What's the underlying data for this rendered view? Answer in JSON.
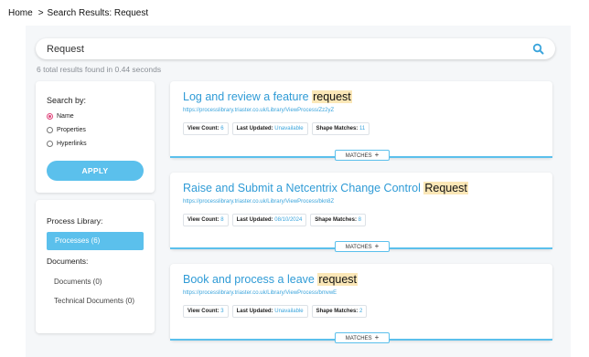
{
  "breadcrumb": {
    "home": "Home",
    "separator": ">",
    "current": "Search Results: Request"
  },
  "search": {
    "value": "Request",
    "placeholder": ""
  },
  "results_summary": "6 total results found in 0.44 seconds",
  "filter": {
    "title": "Search by:",
    "options": [
      {
        "label": "Name",
        "checked": true
      },
      {
        "label": "Properties",
        "checked": false
      },
      {
        "label": "Hyperlinks",
        "checked": false
      }
    ],
    "apply_label": "APPLY"
  },
  "library": {
    "process_heading": "Process Library:",
    "processes_label": "Processes (6)",
    "documents_heading": "Documents:",
    "documents_label": "Documents (0)",
    "technical_label": "Technical Documents (0)"
  },
  "labels": {
    "view_count": "View Count:",
    "last_updated": "Last Updated:",
    "shape_matches": "Shape Matches:",
    "matches": "MATCHES",
    "plus": "+"
  },
  "results": [
    {
      "title_pre": "Log and review a feature ",
      "title_hl": "request",
      "url": "https://processlibrary.triaster.co.uk/Library/ViewProcess/Zz2yZ",
      "view_count": "6",
      "last_updated": "Unavailable",
      "shape_matches": "11"
    },
    {
      "title_pre": "Raise and Submit a Netcentrix Change Control ",
      "title_hl": "Request",
      "url": "https://processlibrary.triaster.co.uk/Library/ViewProcess/bkn8Z",
      "view_count": "8",
      "last_updated": "08/10/2024",
      "shape_matches": "8"
    },
    {
      "title_pre": "Book and process a leave ",
      "title_hl": "request",
      "url": "https://processlibrary.triaster.co.uk/Library/ViewProcess/bmvwE",
      "view_count": "3",
      "last_updated": "Unavailable",
      "shape_matches": "2"
    }
  ],
  "colors": {
    "accent": "#5bc0ec",
    "link": "#2f9bd6",
    "highlight": "#fbe7b7",
    "radio_checked": "#e0447a"
  }
}
